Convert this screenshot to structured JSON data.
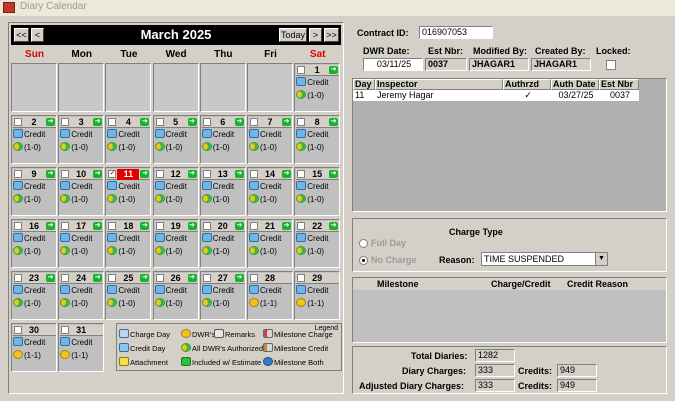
{
  "window": {
    "title": "Diary Calendar"
  },
  "calendar": {
    "nav": {
      "first": "<<",
      "prev": "<",
      "today": "Today",
      "next": ">",
      "last": ">>"
    },
    "month": "March 2025",
    "weekdays": [
      "Sun",
      "Mon",
      "Tue",
      "Wed",
      "Thu",
      "Fri",
      "Sat"
    ],
    "weekend_color": "#e00000",
    "days": [
      {
        "num": "1",
        "credit": "Credit",
        "dwr": "(1-0)",
        "checked": false,
        "included": true
      },
      {
        "num": "2",
        "credit": "Credit",
        "dwr": "(1-0)",
        "checked": false,
        "included": true
      },
      {
        "num": "3",
        "credit": "Credit",
        "dwr": "(1-0)",
        "checked": false,
        "included": true
      },
      {
        "num": "4",
        "credit": "Credit",
        "dwr": "(1-0)",
        "checked": false,
        "included": true
      },
      {
        "num": "5",
        "credit": "Credit",
        "dwr": "(1-0)",
        "checked": false,
        "included": true
      },
      {
        "num": "6",
        "credit": "Credit",
        "dwr": "(1-0)",
        "checked": false,
        "included": true
      },
      {
        "num": "7",
        "credit": "Credit",
        "dwr": "(1-0)",
        "checked": false,
        "included": true
      },
      {
        "num": "8",
        "credit": "Credit",
        "dwr": "(1-0)",
        "checked": false,
        "included": true
      },
      {
        "num": "9",
        "credit": "Credit",
        "dwr": "(1-0)",
        "checked": false,
        "included": true
      },
      {
        "num": "10",
        "credit": "Credit",
        "dwr": "(1-0)",
        "checked": false,
        "included": true
      },
      {
        "num": "11",
        "credit": "Credit",
        "dwr": "(1-0)",
        "checked": true,
        "included": true,
        "today": true
      },
      {
        "num": "12",
        "credit": "Credit",
        "dwr": "(1-0)",
        "checked": false,
        "included": true
      },
      {
        "num": "13",
        "credit": "Credit",
        "dwr": "(1-0)",
        "checked": false,
        "included": true
      },
      {
        "num": "14",
        "credit": "Credit",
        "dwr": "(1-0)",
        "checked": false,
        "included": true
      },
      {
        "num": "15",
        "credit": "Credit",
        "dwr": "(1-0)",
        "checked": false,
        "included": true
      },
      {
        "num": "16",
        "credit": "Credit",
        "dwr": "(1-0)",
        "checked": false,
        "included": true
      },
      {
        "num": "17",
        "credit": "Credit",
        "dwr": "(1-0)",
        "checked": false,
        "included": true
      },
      {
        "num": "18",
        "credit": "Credit",
        "dwr": "(1-0)",
        "checked": false,
        "included": true
      },
      {
        "num": "19",
        "credit": "Credit",
        "dwr": "(1-0)",
        "checked": false,
        "included": true
      },
      {
        "num": "20",
        "credit": "Credit",
        "dwr": "(1-0)",
        "checked": false,
        "included": true
      },
      {
        "num": "21",
        "credit": "Credit",
        "dwr": "(1-0)",
        "checked": false,
        "included": true
      },
      {
        "num": "22",
        "credit": "Credit",
        "dwr": "(1-0)",
        "checked": false,
        "included": true
      },
      {
        "num": "23",
        "credit": "Credit",
        "dwr": "(1-0)",
        "checked": false,
        "included": true
      },
      {
        "num": "24",
        "credit": "Credit",
        "dwr": "(1-0)",
        "checked": false,
        "included": true
      },
      {
        "num": "25",
        "credit": "Credit",
        "dwr": "(1-0)",
        "checked": false,
        "included": true
      },
      {
        "num": "26",
        "credit": "Credit",
        "dwr": "(1-0)",
        "checked": false,
        "included": true
      },
      {
        "num": "27",
        "credit": "Credit",
        "dwr": "(1-0)",
        "checked": false,
        "included": true
      },
      {
        "num": "28",
        "credit": "Credit",
        "dwr": "(1-1)",
        "checked": false,
        "included": false
      },
      {
        "num": "29",
        "credit": "Credit",
        "dwr": "(1-1)",
        "checked": false,
        "included": false
      },
      {
        "num": "30",
        "credit": "Credit",
        "dwr": "(1-1)",
        "checked": false,
        "included": false
      },
      {
        "num": "31",
        "credit": "Credit",
        "dwr": "(1-1)",
        "checked": false,
        "included": false
      }
    ],
    "legend": {
      "title": "Legend",
      "items": [
        {
          "icon": "charge-day-icon",
          "label": "Charge Day"
        },
        {
          "icon": "dwrs-icon",
          "label": "DWR's"
        },
        {
          "icon": "remarks-icon",
          "label": "Remarks"
        },
        {
          "icon": "milestone-charge-icon",
          "label": "Milestone Charge"
        },
        {
          "icon": "credit-day-icon",
          "label": "Credit Day"
        },
        {
          "icon": "all-dwrs-authorized-icon",
          "label": "All DWR's Authorized"
        },
        {
          "icon": "milestone-credit-icon",
          "label": "Milestone Credit"
        },
        {
          "icon": "attachment-icon",
          "label": "Attachment"
        },
        {
          "icon": "included-icon",
          "label": "Included w/ Estimate"
        },
        {
          "icon": "milestone-both-icon",
          "label": "Milestone Both"
        }
      ]
    }
  },
  "contract": {
    "label": "Contract ID:",
    "value": "016907053"
  },
  "dwr_info": {
    "headers": [
      "DWR Date:",
      "Est Nbr:",
      "Modified By:",
      "Created By:",
      "Locked:"
    ],
    "dwr_date": "03/11/25",
    "est_nbr": "0037",
    "modified_by": "JHAGAR1",
    "created_by": "JHAGAR1",
    "locked": false
  },
  "inspectors": {
    "columns": [
      "Day",
      "Inspector",
      "Authrzd",
      "Auth Date",
      "Est Nbr"
    ],
    "rows": [
      {
        "day": "11",
        "inspector": "Jeremy Hagar",
        "authorized": "✓",
        "auth_date": "03/27/25",
        "est_nbr": "0037"
      }
    ]
  },
  "charge_type": {
    "title": "Charge Type",
    "options": [
      "Full Day",
      "No Charge"
    ],
    "selected": "No Charge",
    "reason_label": "Reason:",
    "reason_value": "TIME SUSPENDED"
  },
  "milestones": {
    "columns": [
      "Milestone",
      "Charge/Credit",
      "Credit Reason"
    ]
  },
  "totals": {
    "total_diaries_label": "Total Diaries:",
    "total_diaries": "1282",
    "diary_charges_label": "Diary Charges:",
    "diary_charges": "333",
    "credits_label": "Credits:",
    "credits": "949",
    "adjusted_label": "Adjusted Diary Charges:",
    "adjusted_charges": "333",
    "adjusted_credits": "949"
  }
}
